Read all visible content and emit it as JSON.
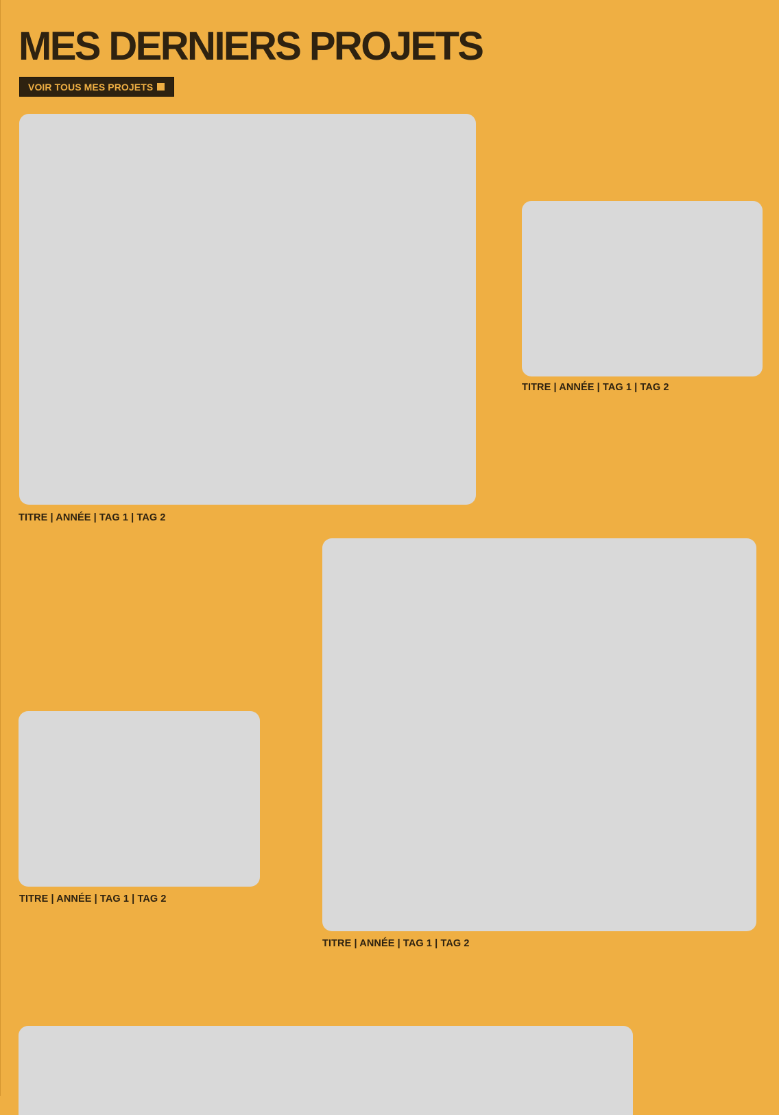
{
  "page": {
    "title": "MES DERNIERS PROJETS",
    "cta_label": "VOIR TOUS MES PROJETS",
    "cta_icon": "square-icon"
  },
  "colors": {
    "background": "#EFAF43",
    "text": "#2E2210",
    "placeholder": "#D9D9D9"
  },
  "projects": [
    {
      "caption": "TITRE | ANNÉE | TAG 1 | TAG 2"
    },
    {
      "caption": "TITRE | ANNÉE | TAG 1 | TAG 2"
    },
    {
      "caption": "TITRE | ANNÉE | TAG 1 | TAG 2"
    },
    {
      "caption": "TITRE | ANNÉE | TAG 1 | TAG 2"
    },
    {
      "caption": ""
    }
  ]
}
